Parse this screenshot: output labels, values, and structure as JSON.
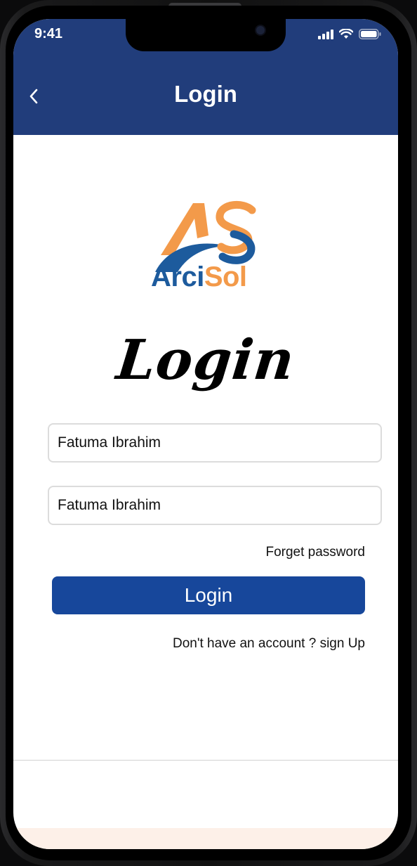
{
  "status_bar": {
    "time": "9:41"
  },
  "app_bar": {
    "title": "Login"
  },
  "logo": {
    "word_part_1": "Arci",
    "word_part_2": "Sol"
  },
  "heading": "Login",
  "form": {
    "username_value": "Fatuma Ibrahim",
    "password_value": "Fatuma Ibrahim",
    "forget_password": "Forget password",
    "login_button": "Login",
    "signup_prompt": "Don't have an account ? sign Up"
  },
  "colors": {
    "app_bar": "#213d7b",
    "button": "#17479b",
    "logo_blue": "#1d5b9d",
    "logo_orange": "#f39a4a"
  }
}
